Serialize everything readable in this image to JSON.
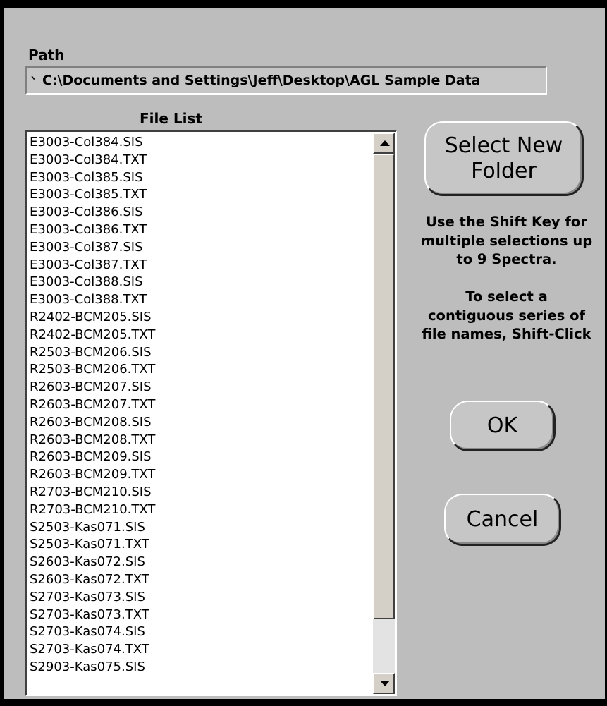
{
  "path": {
    "label": "Path",
    "icon": "tree-icon",
    "value": "C:\\Documents and Settings\\Jeff\\Desktop\\AGL Sample Data"
  },
  "file_list": {
    "label": "File List",
    "items": [
      "E3003-Col384.SIS",
      "E3003-Col384.TXT",
      "E3003-Col385.SIS",
      "E3003-Col385.TXT",
      "E3003-Col386.SIS",
      "E3003-Col386.TXT",
      "E3003-Col387.SIS",
      "E3003-Col387.TXT",
      "E3003-Col388.SIS",
      "E3003-Col388.TXT",
      "R2402-BCM205.SIS",
      "R2402-BCM205.TXT",
      "R2503-BCM206.SIS",
      "R2503-BCM206.TXT",
      "R2603-BCM207.SIS",
      "R2603-BCM207.TXT",
      "R2603-BCM208.SIS",
      "R2603-BCM208.TXT",
      "R2603-BCM209.SIS",
      "R2603-BCM209.TXT",
      "R2703-BCM210.SIS",
      "R2703-BCM210.TXT",
      "S2503-Kas071.SIS",
      "S2503-Kas071.TXT",
      "S2603-Kas072.SIS",
      "S2603-Kas072.TXT",
      "S2703-Kas073.SIS",
      "S2703-Kas073.TXT",
      "S2703-Kas074.SIS",
      "S2703-Kas074.TXT",
      "S2903-Kas075.SIS"
    ]
  },
  "buttons": {
    "select_new_folder": "Select New\nFolder",
    "ok": "OK",
    "cancel": "Cancel"
  },
  "help_text": "Use the Shift Key for\nmultiple selections up\nto 9 Spectra.\n\nTo select a\ncontiguous series of\nfile names, Shift-Click"
}
